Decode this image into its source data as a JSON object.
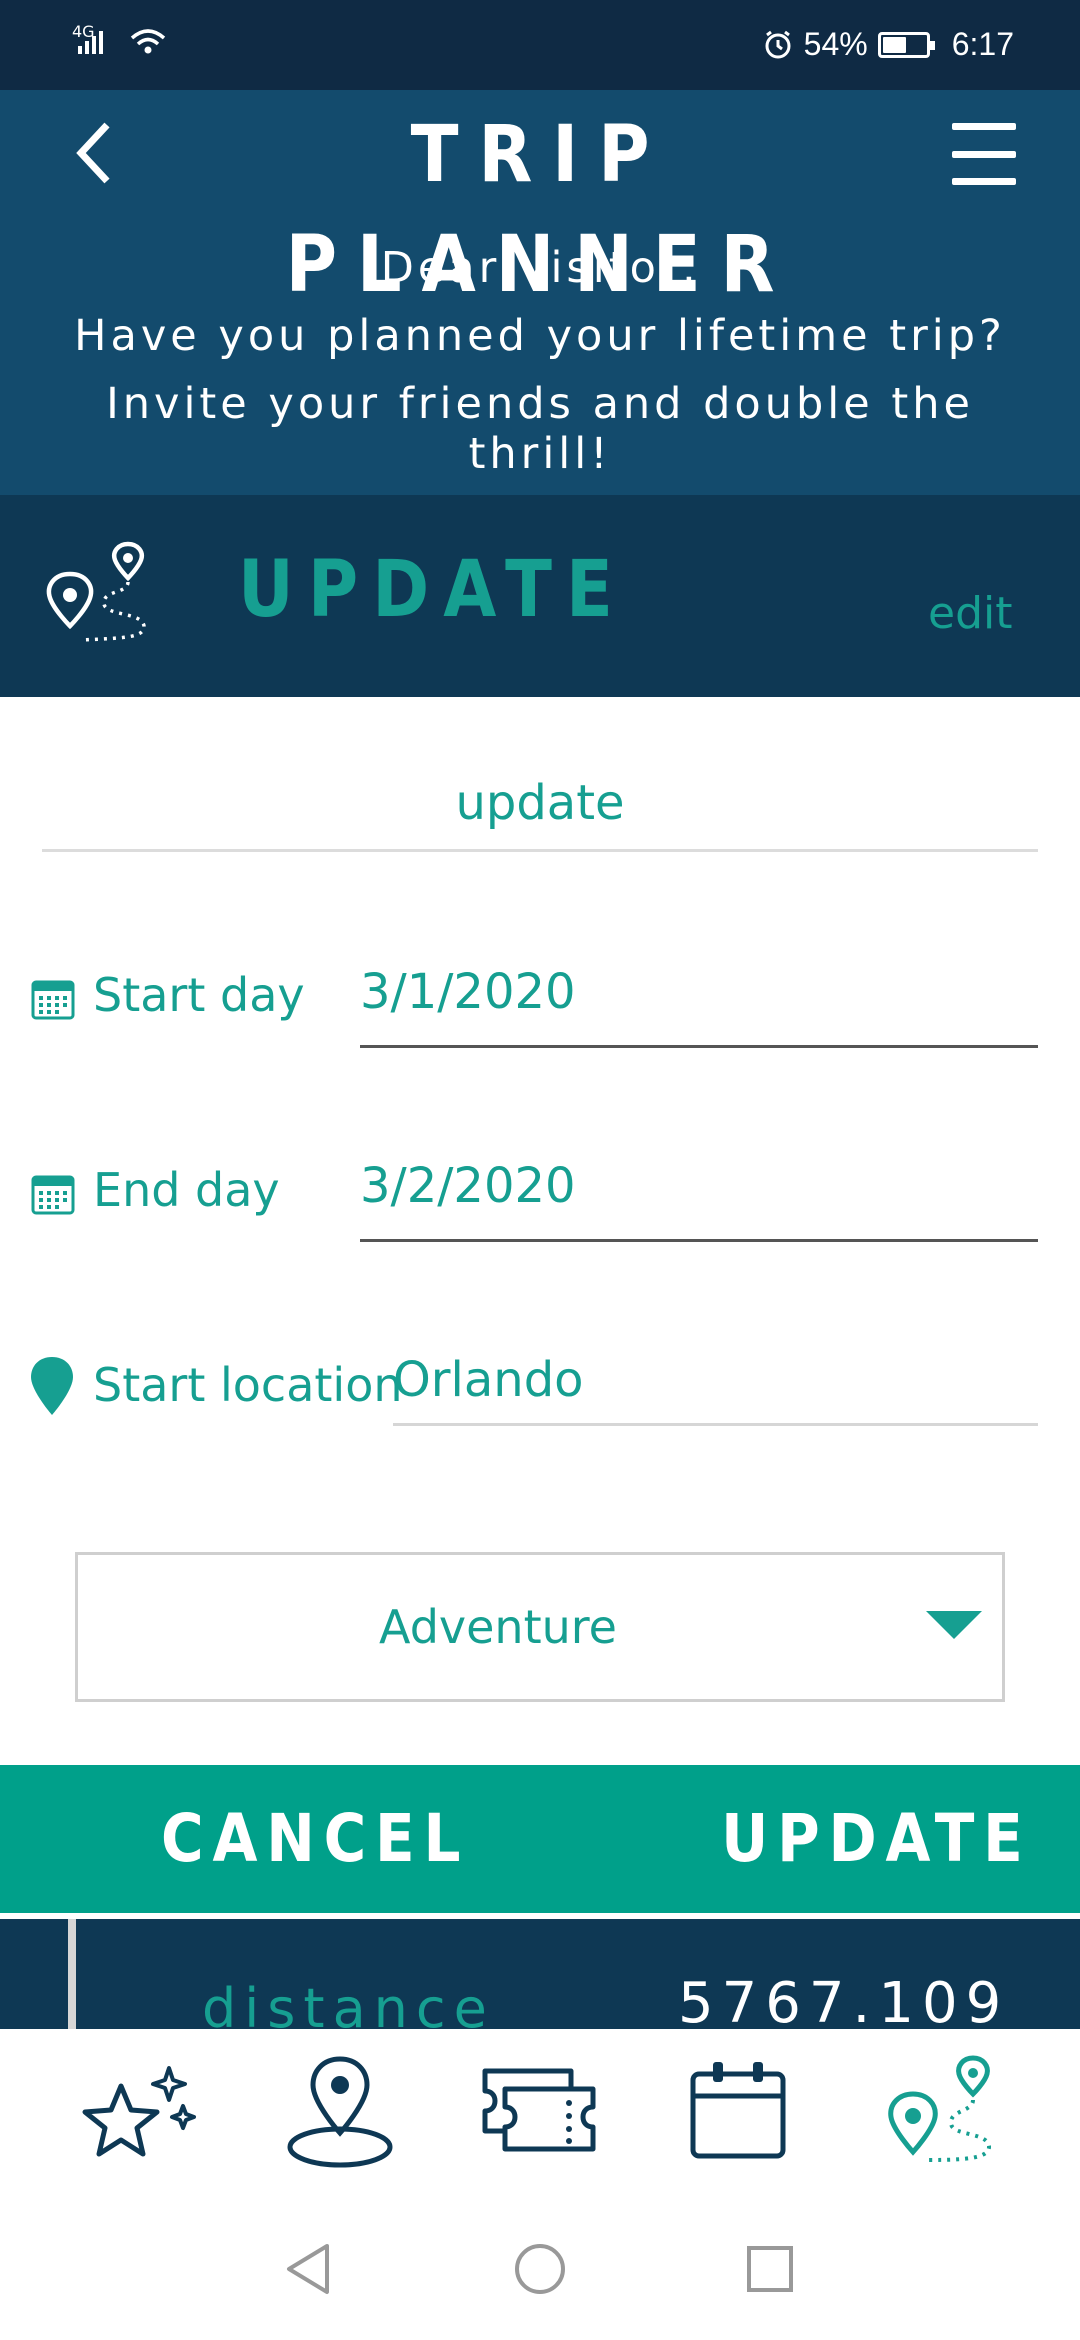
{
  "status_bar": {
    "network": "4G",
    "battery": "54%",
    "battery_level": 0.54,
    "time": "6:17"
  },
  "header": {
    "title": "TRIP PLANNER",
    "greeting_lines": [
      "Dear Visitor,",
      "Have you planned your lifetime trip?",
      "Invite your friends and double the thrill!"
    ]
  },
  "section": {
    "title": "UPDATE",
    "edit_label": "edit"
  },
  "form": {
    "trip_name": "update",
    "start_day": {
      "label": "Start day",
      "value": "3/1/2020"
    },
    "end_day": {
      "label": "End day",
      "value": "3/2/2020"
    },
    "start_location": {
      "label": "Start location",
      "value": "Orlando"
    },
    "category": "Adventure"
  },
  "actions": {
    "cancel_label": "CANCEL",
    "update_label": "UPDATE"
  },
  "result": {
    "label": "distance",
    "value": "5767.109"
  },
  "bottom_nav": {
    "items": [
      "sparkle-star-icon",
      "map-pin-icon",
      "tickets-icon",
      "calendar-icon",
      "route-icon"
    ],
    "active": "route-icon"
  },
  "colors": {
    "header_bg": "#134b6d",
    "section_bg": "#0e3854",
    "accent": "#169f91",
    "action_bg": "#00a08a",
    "nav_icon": "#0e3854"
  }
}
